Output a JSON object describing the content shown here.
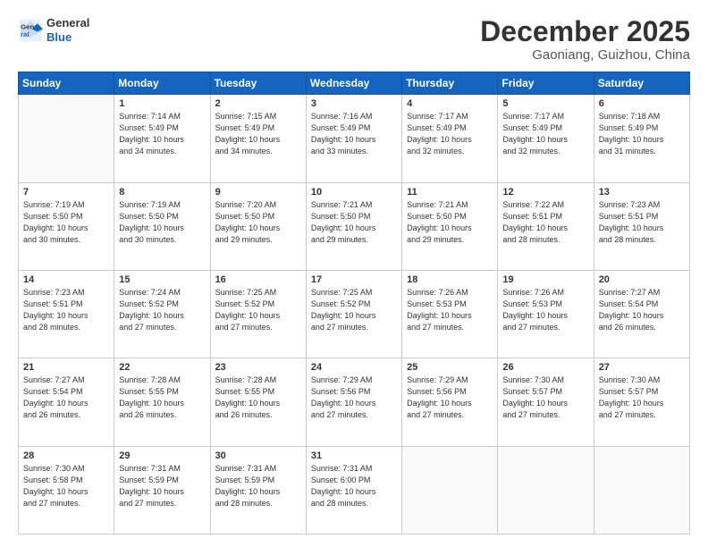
{
  "header": {
    "logo_line1": "General",
    "logo_line2": "Blue",
    "month": "December 2025",
    "location": "Gaoniang, Guizhou, China"
  },
  "weekdays": [
    "Sunday",
    "Monday",
    "Tuesday",
    "Wednesday",
    "Thursday",
    "Friday",
    "Saturday"
  ],
  "weeks": [
    [
      {
        "day": "",
        "info": ""
      },
      {
        "day": "1",
        "info": "Sunrise: 7:14 AM\nSunset: 5:49 PM\nDaylight: 10 hours\nand 34 minutes."
      },
      {
        "day": "2",
        "info": "Sunrise: 7:15 AM\nSunset: 5:49 PM\nDaylight: 10 hours\nand 34 minutes."
      },
      {
        "day": "3",
        "info": "Sunrise: 7:16 AM\nSunset: 5:49 PM\nDaylight: 10 hours\nand 33 minutes."
      },
      {
        "day": "4",
        "info": "Sunrise: 7:17 AM\nSunset: 5:49 PM\nDaylight: 10 hours\nand 32 minutes."
      },
      {
        "day": "5",
        "info": "Sunrise: 7:17 AM\nSunset: 5:49 PM\nDaylight: 10 hours\nand 32 minutes."
      },
      {
        "day": "6",
        "info": "Sunrise: 7:18 AM\nSunset: 5:49 PM\nDaylight: 10 hours\nand 31 minutes."
      }
    ],
    [
      {
        "day": "7",
        "info": "Sunrise: 7:19 AM\nSunset: 5:50 PM\nDaylight: 10 hours\nand 30 minutes."
      },
      {
        "day": "8",
        "info": "Sunrise: 7:19 AM\nSunset: 5:50 PM\nDaylight: 10 hours\nand 30 minutes."
      },
      {
        "day": "9",
        "info": "Sunrise: 7:20 AM\nSunset: 5:50 PM\nDaylight: 10 hours\nand 29 minutes."
      },
      {
        "day": "10",
        "info": "Sunrise: 7:21 AM\nSunset: 5:50 PM\nDaylight: 10 hours\nand 29 minutes."
      },
      {
        "day": "11",
        "info": "Sunrise: 7:21 AM\nSunset: 5:50 PM\nDaylight: 10 hours\nand 29 minutes."
      },
      {
        "day": "12",
        "info": "Sunrise: 7:22 AM\nSunset: 5:51 PM\nDaylight: 10 hours\nand 28 minutes."
      },
      {
        "day": "13",
        "info": "Sunrise: 7:23 AM\nSunset: 5:51 PM\nDaylight: 10 hours\nand 28 minutes."
      }
    ],
    [
      {
        "day": "14",
        "info": "Sunrise: 7:23 AM\nSunset: 5:51 PM\nDaylight: 10 hours\nand 28 minutes."
      },
      {
        "day": "15",
        "info": "Sunrise: 7:24 AM\nSunset: 5:52 PM\nDaylight: 10 hours\nand 27 minutes."
      },
      {
        "day": "16",
        "info": "Sunrise: 7:25 AM\nSunset: 5:52 PM\nDaylight: 10 hours\nand 27 minutes."
      },
      {
        "day": "17",
        "info": "Sunrise: 7:25 AM\nSunset: 5:52 PM\nDaylight: 10 hours\nand 27 minutes."
      },
      {
        "day": "18",
        "info": "Sunrise: 7:26 AM\nSunset: 5:53 PM\nDaylight: 10 hours\nand 27 minutes."
      },
      {
        "day": "19",
        "info": "Sunrise: 7:26 AM\nSunset: 5:53 PM\nDaylight: 10 hours\nand 27 minutes."
      },
      {
        "day": "20",
        "info": "Sunrise: 7:27 AM\nSunset: 5:54 PM\nDaylight: 10 hours\nand 26 minutes."
      }
    ],
    [
      {
        "day": "21",
        "info": "Sunrise: 7:27 AM\nSunset: 5:54 PM\nDaylight: 10 hours\nand 26 minutes."
      },
      {
        "day": "22",
        "info": "Sunrise: 7:28 AM\nSunset: 5:55 PM\nDaylight: 10 hours\nand 26 minutes."
      },
      {
        "day": "23",
        "info": "Sunrise: 7:28 AM\nSunset: 5:55 PM\nDaylight: 10 hours\nand 26 minutes."
      },
      {
        "day": "24",
        "info": "Sunrise: 7:29 AM\nSunset: 5:56 PM\nDaylight: 10 hours\nand 27 minutes."
      },
      {
        "day": "25",
        "info": "Sunrise: 7:29 AM\nSunset: 5:56 PM\nDaylight: 10 hours\nand 27 minutes."
      },
      {
        "day": "26",
        "info": "Sunrise: 7:30 AM\nSunset: 5:57 PM\nDaylight: 10 hours\nand 27 minutes."
      },
      {
        "day": "27",
        "info": "Sunrise: 7:30 AM\nSunset: 5:57 PM\nDaylight: 10 hours\nand 27 minutes."
      }
    ],
    [
      {
        "day": "28",
        "info": "Sunrise: 7:30 AM\nSunset: 5:58 PM\nDaylight: 10 hours\nand 27 minutes."
      },
      {
        "day": "29",
        "info": "Sunrise: 7:31 AM\nSunset: 5:59 PM\nDaylight: 10 hours\nand 27 minutes."
      },
      {
        "day": "30",
        "info": "Sunrise: 7:31 AM\nSunset: 5:59 PM\nDaylight: 10 hours\nand 28 minutes."
      },
      {
        "day": "31",
        "info": "Sunrise: 7:31 AM\nSunset: 6:00 PM\nDaylight: 10 hours\nand 28 minutes."
      },
      {
        "day": "",
        "info": ""
      },
      {
        "day": "",
        "info": ""
      },
      {
        "day": "",
        "info": ""
      }
    ]
  ]
}
